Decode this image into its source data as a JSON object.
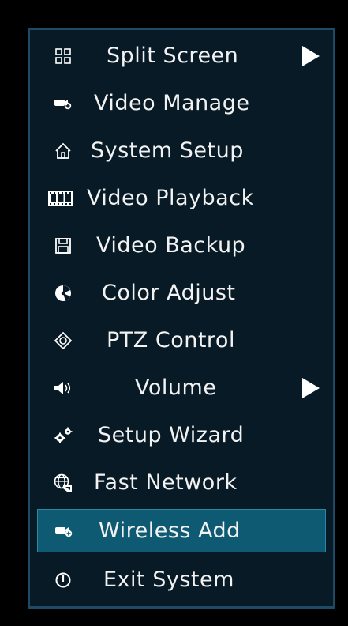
{
  "menu": {
    "items": [
      {
        "label": "Split Screen",
        "icon": "split-screen-icon",
        "submenu": true
      },
      {
        "label": "Video Manage",
        "icon": "camera-add-icon"
      },
      {
        "label": "System Setup",
        "icon": "home-icon"
      },
      {
        "label": "Video Playback",
        "icon": "film-strip-icon"
      },
      {
        "label": "Video Backup",
        "icon": "floppy-disk-icon"
      },
      {
        "label": "Color Adjust",
        "icon": "color-palette-icon"
      },
      {
        "label": "PTZ Control",
        "icon": "ptz-direction-icon"
      },
      {
        "label": "Volume",
        "icon": "speaker-icon",
        "submenu": true
      },
      {
        "label": "Setup Wizard",
        "icon": "gears-icon"
      },
      {
        "label": "Fast Network",
        "icon": "globe-network-icon"
      },
      {
        "label": "Wireless Add",
        "icon": "camera-add-icon",
        "selected": true
      },
      {
        "label": "Exit System",
        "icon": "power-icon"
      }
    ]
  },
  "colors": {
    "background": "#000000",
    "panel": "#081a26",
    "panel_border": "#1f4a66",
    "selected": "#0f5a73",
    "text": "#f2f2f2"
  }
}
